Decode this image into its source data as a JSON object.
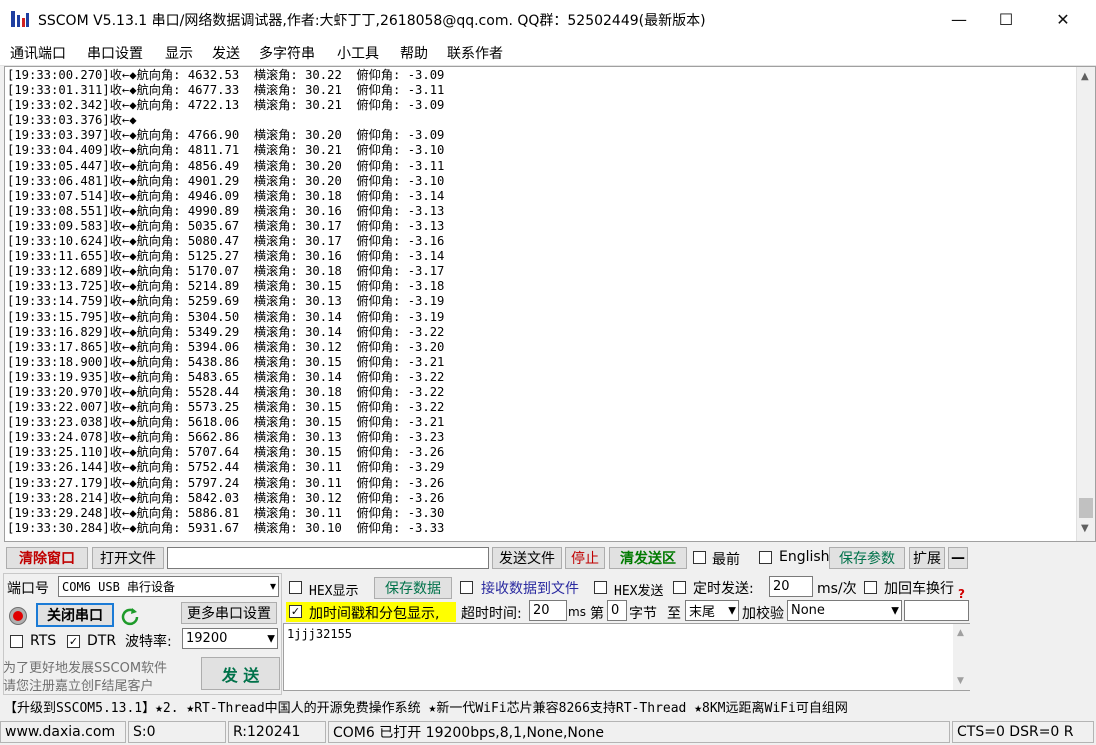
{
  "window": {
    "title": "SSCOM V5.13.1 串口/网络数据调试器,作者:大虾丁丁,2618058@qq.com. QQ群：52502449(最新版本)",
    "minimize": "—",
    "maximize": "☐",
    "close": "✕"
  },
  "menu": {
    "items": [
      "通讯端口",
      "串口设置",
      "显示",
      "发送",
      "多字符串",
      "小工具",
      "帮助",
      "联系作者"
    ]
  },
  "receive": {
    "lines": [
      "[19:33:00.270]收←◆航向角: 4632.53  横滚角: 30.22  俯仰角: -3.09",
      "[19:33:01.311]收←◆航向角: 4677.33  横滚角: 30.21  俯仰角: -3.11",
      "[19:33:02.342]收←◆航向角: 4722.13  横滚角: 30.21  俯仰角: -3.09",
      "[19:33:03.376]收←◆",
      "[19:33:03.397]收←◆航向角: 4766.90  横滚角: 30.20  俯仰角: -3.09",
      "[19:33:04.409]收←◆航向角: 4811.71  横滚角: 30.21  俯仰角: -3.10",
      "[19:33:05.447]收←◆航向角: 4856.49  横滚角: 30.20  俯仰角: -3.11",
      "[19:33:06.481]收←◆航向角: 4901.29  横滚角: 30.20  俯仰角: -3.10",
      "[19:33:07.514]收←◆航向角: 4946.09  横滚角: 30.18  俯仰角: -3.14",
      "[19:33:08.551]收←◆航向角: 4990.89  横滚角: 30.16  俯仰角: -3.13",
      "[19:33:09.583]收←◆航向角: 5035.67  横滚角: 30.17  俯仰角: -3.13",
      "[19:33:10.624]收←◆航向角: 5080.47  横滚角: 30.17  俯仰角: -3.16",
      "[19:33:11.655]收←◆航向角: 5125.27  横滚角: 30.16  俯仰角: -3.14",
      "[19:33:12.689]收←◆航向角: 5170.07  横滚角: 30.18  俯仰角: -3.17",
      "[19:33:13.725]收←◆航向角: 5214.89  横滚角: 30.15  俯仰角: -3.18",
      "[19:33:14.759]收←◆航向角: 5259.69  横滚角: 30.13  俯仰角: -3.19",
      "[19:33:15.795]收←◆航向角: 5304.50  横滚角: 30.14  俯仰角: -3.19",
      "[19:33:16.829]收←◆航向角: 5349.29  横滚角: 30.14  俯仰角: -3.22",
      "[19:33:17.865]收←◆航向角: 5394.06  横滚角: 30.12  俯仰角: -3.20",
      "[19:33:18.900]收←◆航向角: 5438.86  横滚角: 30.15  俯仰角: -3.21",
      "[19:33:19.935]收←◆航向角: 5483.65  横滚角: 30.14  俯仰角: -3.22",
      "[19:33:20.970]收←◆航向角: 5528.44  横滚角: 30.18  俯仰角: -3.22",
      "[19:33:22.007]收←◆航向角: 5573.25  横滚角: 30.15  俯仰角: -3.22",
      "[19:33:23.038]收←◆航向角: 5618.06  横滚角: 30.15  俯仰角: -3.21",
      "[19:33:24.078]收←◆航向角: 5662.86  横滚角: 30.13  俯仰角: -3.23",
      "[19:33:25.110]收←◆航向角: 5707.64  横滚角: 30.15  俯仰角: -3.26",
      "[19:33:26.144]收←◆航向角: 5752.44  横滚角: 30.11  俯仰角: -3.29",
      "[19:33:27.179]收←◆航向角: 5797.24  横滚角: 30.11  俯仰角: -3.26",
      "[19:33:28.214]收←◆航向角: 5842.03  横滚角: 30.12  俯仰角: -3.26",
      "[19:33:29.248]收←◆航向角: 5886.81  横滚角: 30.11  俯仰角: -3.30",
      "[19:33:30.284]收←◆航向角: 5931.67  横滚角: 30.10  俯仰角: -3.33"
    ]
  },
  "toolbar": {
    "clear": "清除窗口",
    "open_file": "打开文件",
    "file_path": "",
    "send_file": "发送文件",
    "stop": "停止",
    "clear_send": "清发送区",
    "topmost": "最前",
    "english": "English",
    "save_params": "保存参数",
    "expand": "扩展",
    "collapse": "—"
  },
  "port": {
    "label": "端口号",
    "value": "COM6 USB 串行设备",
    "close_port": "关闭串口",
    "more_settings": "更多串口设置",
    "rts": "RTS",
    "dtr": "DTR",
    "baud_label": "波特率:",
    "baud_value": "19200",
    "promo_line1": "为了更好地发展SSCOM软件",
    "promo_line2": "请您注册嘉立创F结尾客户",
    "send": "发 送"
  },
  "options": {
    "hex_display": "HEX显示",
    "save_data": "保存数据",
    "recv_to_file": "接收数据到文件",
    "hex_send": "HEX发送",
    "timed_send": "定时发送:",
    "interval": "20",
    "interval_unit": "ms/次",
    "append_crlf": "加回车换行",
    "timestamp": "加时间戳和分包显示,",
    "timeout_label": "超时时间:",
    "timeout_value": "20",
    "ms": "ms",
    "nth": "第",
    "byte_value": "0",
    "byte_label": "字节",
    "to": "至",
    "end_value": "末尾",
    "checksum_label": "加校验",
    "checksum_value": "None",
    "help_mark": "?"
  },
  "send_area": {
    "text": "1jjj32155"
  },
  "ad_text": "【升级到SSCOM5.13.1】★2. ★RT-Thread中国人的开源免费操作系统 ★新一代WiFi芯片兼容8266支持RT-Thread ★8KM远距离WiFi可自组网",
  "status": {
    "site": "www.daxia.com",
    "sent": "S:0",
    "received": "R:120241",
    "port_state": "COM6 已打开  19200bps,8,1,None,None",
    "lines": "CTS=0 DSR=0 R"
  }
}
